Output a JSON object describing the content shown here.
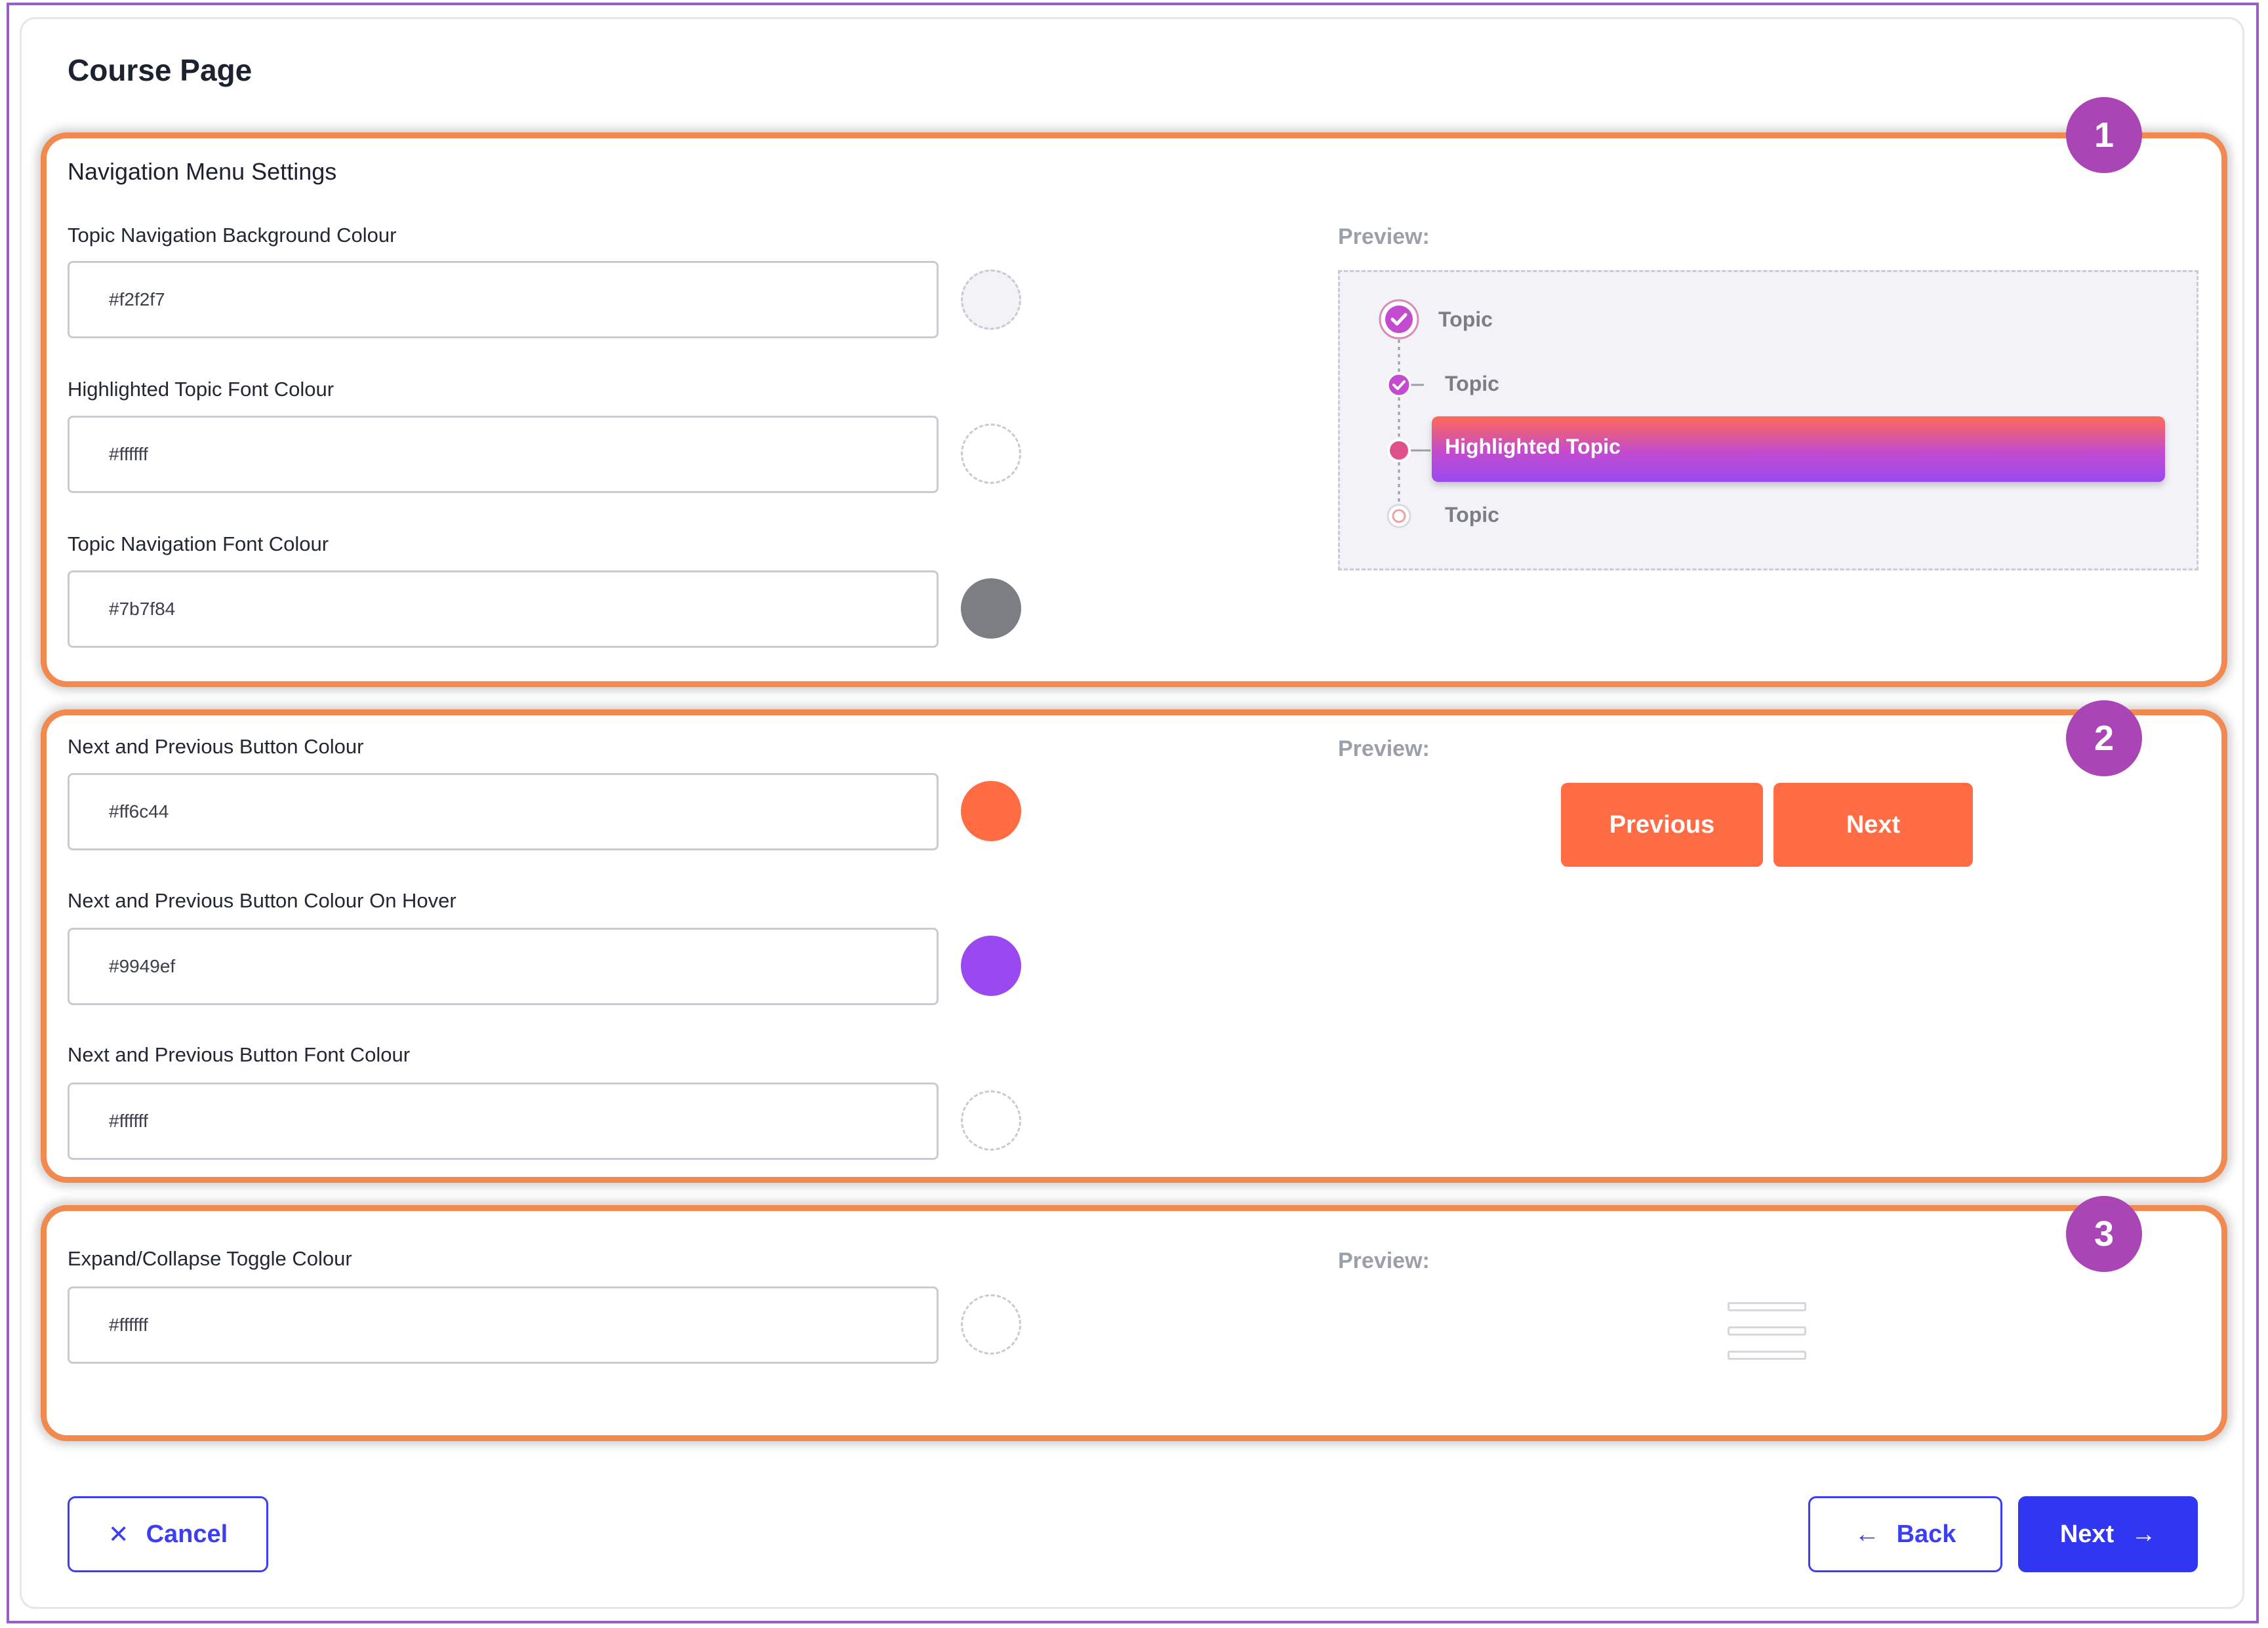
{
  "page": {
    "title": "Course Page"
  },
  "section1": {
    "badge": "1",
    "title": "Navigation Menu Settings",
    "fields": [
      {
        "label": "Topic Navigation Background Colour",
        "value": "#f2f2f7",
        "swatch": "#f2f2f7"
      },
      {
        "label": "Highlighted Topic Font Colour",
        "value": "#ffffff",
        "swatch": "#ffffff"
      },
      {
        "label": "Topic Navigation Font Colour",
        "value": "#7b7f84",
        "swatch": "#7b7f84"
      }
    ],
    "preview": {
      "label": "Preview:",
      "topics": [
        "Topic",
        "Topic",
        "Highlighted Topic",
        "Topic"
      ]
    }
  },
  "section2": {
    "badge": "2",
    "fields": [
      {
        "label": "Next and Previous Button Colour",
        "value": "#ff6c44",
        "swatch": "#ff6c44"
      },
      {
        "label": "Next and Previous Button Colour On Hover",
        "value": "#9949ef",
        "swatch": "#9949ef"
      },
      {
        "label": "Next and Previous Button Font Colour",
        "value": "#ffffff",
        "swatch": "#ffffff"
      }
    ],
    "preview": {
      "label": "Preview:",
      "previous": "Previous",
      "next": "Next"
    }
  },
  "section3": {
    "badge": "3",
    "fields": [
      {
        "label": "Expand/Collapse Toggle Colour",
        "value": "#ffffff",
        "swatch": "#ffffff"
      }
    ],
    "preview": {
      "label": "Preview:",
      "icon": "hamburger-icon"
    }
  },
  "footer": {
    "cancel": "Cancel",
    "back": "Back",
    "next": "Next"
  },
  "colors": {
    "section_outline": "#f2894e",
    "badge": "#a945b5",
    "primary": "#3136f0",
    "gradient_start": "#ff6a55",
    "gradient_end": "#9949ef",
    "check": "#e0508a"
  }
}
